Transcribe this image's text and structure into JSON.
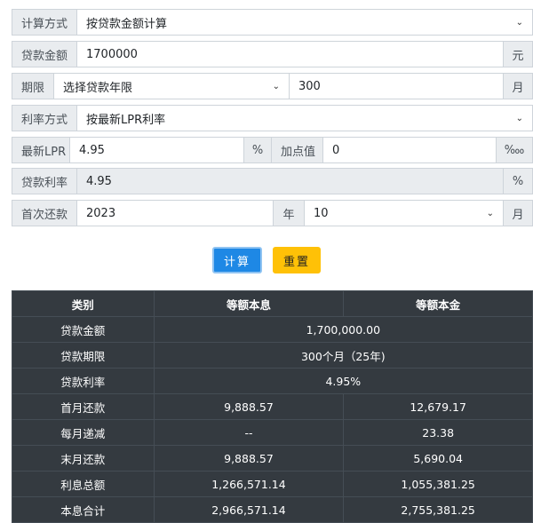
{
  "form": {
    "calc_method": {
      "label": "计算方式",
      "value": "按贷款金额计算"
    },
    "loan_amount": {
      "label": "贷款金额",
      "value": "1700000",
      "unit": "元"
    },
    "term": {
      "label": "期限",
      "select_value": "选择贷款年限",
      "months": "300",
      "unit": "月"
    },
    "rate_method": {
      "label": "利率方式",
      "value": "按最新LPR利率"
    },
    "lpr": {
      "label": "最新LPR",
      "value": "4.95",
      "unit": "%",
      "bp_label": "加点值",
      "bp_value": "0",
      "bp_unit": "‱"
    },
    "loan_rate": {
      "label": "贷款利率",
      "value": "4.95",
      "unit": "%"
    },
    "first_repay": {
      "label": "首次还款",
      "year": "2023",
      "year_unit": "年",
      "month": "10",
      "month_unit": "月"
    }
  },
  "buttons": {
    "calc": "计算",
    "reset": "重置"
  },
  "results": {
    "headers": [
      "类别",
      "等额本息",
      "等额本金"
    ],
    "rows": [
      {
        "label": "贷款金额",
        "merged": "1,700,000.00"
      },
      {
        "label": "贷款期限",
        "merged": "300个月（25年)"
      },
      {
        "label": "贷款利率",
        "merged": "4.95%"
      },
      {
        "label": "首月还款",
        "a": "9,888.57",
        "b": "12,679.17"
      },
      {
        "label": "每月递减",
        "a": "--",
        "b": "23.38"
      },
      {
        "label": "末月还款",
        "a": "9,888.57",
        "b": "5,690.04"
      },
      {
        "label": "利息总额",
        "a": "1,266,571.14",
        "b": "1,055,381.25"
      },
      {
        "label": "本息合计",
        "a": "2,966,571.14",
        "b": "2,755,381.25"
      }
    ]
  }
}
